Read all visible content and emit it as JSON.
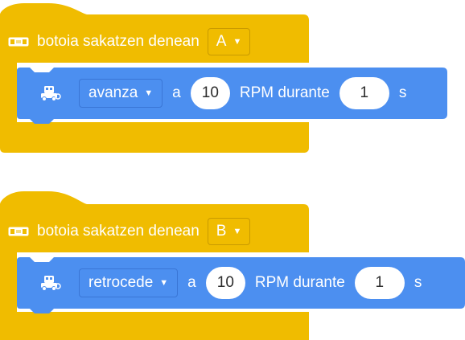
{
  "scripts": [
    {
      "hat": {
        "label": "botoia sakatzen denean",
        "button": "A"
      },
      "command": {
        "direction": "avanza",
        "a_label": "a",
        "rpm_value": "10",
        "rpm_label": "RPM durante",
        "duration_value": "1",
        "unit": "s"
      }
    },
    {
      "hat": {
        "label": "botoia sakatzen denean",
        "button": "B"
      },
      "command": {
        "direction": "retrocede",
        "a_label": "a",
        "rpm_value": "10",
        "rpm_label": "RPM durante",
        "duration_value": "1",
        "unit": "s"
      }
    }
  ],
  "colors": {
    "event_block": "#f0bc00",
    "motion_block": "#4c8ff0",
    "field_bg": "#ffffff",
    "field_text": "#2c2c2c"
  },
  "icons": {
    "hat": "board-icon",
    "command": "robot-icon",
    "dropdown": "caret-down-icon"
  }
}
